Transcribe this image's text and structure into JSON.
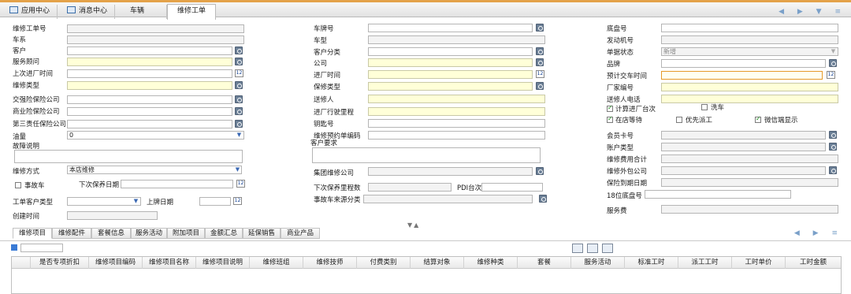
{
  "tabs": [
    "应用中心",
    "消息中心",
    "车辆",
    "维修工单"
  ],
  "nav_arrows": "◀ ▶ ▼ ≡",
  "left": {
    "order_no": "维修工单号",
    "vehicle_series": "车系",
    "customer": "客户",
    "service_advisor": "服务顾问",
    "last_entry_time": "上次进厂时间",
    "repair_type": "维修类型",
    "compulsory_insurer": "交强险保险公司",
    "commercial_insurer": "商业险保险公司",
    "third_party_insurer": "第三责任保险公司",
    "fuel": "油量",
    "fuel_value": "0",
    "fault_desc": "故障说明",
    "repair_mode": "维修方式",
    "repair_mode_value": "本店维修",
    "accident_car": "事故车",
    "next_maint_date": "下次保养日期",
    "order_customer_type": "工单客户类型",
    "plate_date": "上牌日期",
    "created_time": "创建时间"
  },
  "mid": {
    "plate_no": "车牌号",
    "model": "车型",
    "customer_category": "客户分类",
    "company": "公司",
    "entry_time": "进厂时间",
    "maint_type": "保修类型",
    "sender": "送修人",
    "entry_mileage": "进厂行驶里程",
    "key_no": "钥匙号",
    "appointment_no": "维修预约单编码",
    "customer_request": "客户要求",
    "group_repair_company": "集团维修公司",
    "next_maint_mileage": "下次保养里程数",
    "pdi": "PDI台次",
    "accident_source": "事故车来源分类"
  },
  "right": {
    "chassis_no": "底盘号",
    "engine_no": "发动机号",
    "doc_status": "单据状态",
    "doc_status_value": "新增",
    "brand": "品牌",
    "est_delivery": "预计交车时间",
    "factory_no": "厂家编号",
    "sender_phone": "送修人电话",
    "count_entry": "计算进厂台次",
    "wash": "洗车",
    "waiting": "在店等待",
    "priority": "优先派工",
    "wechat": "微信端显示",
    "member_card": "会员卡号",
    "account_type": "账户类型",
    "repair_total": "维修费用合计",
    "outsource_company": "维修外包公司",
    "insurance_expiry": "保险到期日期",
    "chassis_18": "18位底盘号",
    "service_fee": "服务费"
  },
  "splitter": "▼▲",
  "bottom_tabs": [
    "维修项目",
    "维修配件",
    "套餐信息",
    "服务活动",
    "附加项目",
    "金额汇总",
    "延保销售",
    "商业产品"
  ],
  "bottom_nav": "◀ ▶ ≡",
  "grid_headers": [
    "是否专项折扣",
    "维修项目编码",
    "维修项目名称",
    "维修项目说明",
    "维修班组",
    "维修技师",
    "付费类别",
    "结算对象",
    "维修种类",
    "套餐",
    "服务活动",
    "标准工时",
    "派工工时",
    "工时单价",
    "工时金额"
  ],
  "calendar_icon": "12",
  "colors": {
    "accent": "#e4a24a",
    "required_field": "#ffffd8",
    "focus": "#e69a2a"
  }
}
